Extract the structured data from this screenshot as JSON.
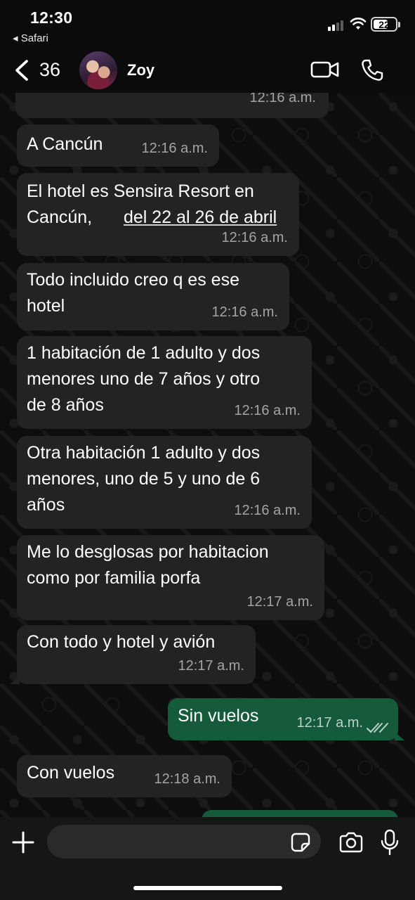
{
  "status_bar": {
    "time": "12:30",
    "back_app": "◂ Safari",
    "battery": "22"
  },
  "header": {
    "back_count": "36",
    "contact_name": "Zoy",
    "icons": [
      "chevron-left-icon",
      "video-camera-icon",
      "phone-icon"
    ]
  },
  "messages": [
    {
      "direction": "in",
      "lines": [
        ""
      ],
      "time": "12:16 a.m."
    },
    {
      "direction": "in",
      "lines": [
        "A Cancún"
      ],
      "time": "12:16 a.m."
    },
    {
      "direction": "in",
      "lines": [
        "El hotel es Sensira Resort en",
        "Cancún, "
      ],
      "link": "del 22 al 26 de abril",
      "time": "12:16 a.m."
    },
    {
      "direction": "in",
      "lines": [
        "Todo incluido creo q es ese",
        "hotel"
      ],
      "time": "12:16 a.m."
    },
    {
      "direction": "in",
      "lines": [
        "1 habitación de 1 adulto y dos",
        "menores uno de 7 años y otro",
        "de 8 años"
      ],
      "time": "12:16 a.m."
    },
    {
      "direction": "in",
      "lines": [
        "Otra habitación 1 adulto y dos",
        "menores, uno de 5 y uno de 6",
        "años"
      ],
      "time": "12:16 a.m."
    },
    {
      "direction": "in",
      "lines": [
        "Me lo desglosas por habitacion",
        "como por familia porfa"
      ],
      "time": "12:17 a.m."
    },
    {
      "direction": "in",
      "lines": [
        "Con todo y hotel y avión"
      ],
      "time": "12:17 a.m."
    },
    {
      "direction": "out",
      "lines": [
        "Sin vuelos"
      ],
      "time": "12:17 a.m.",
      "status": "read"
    },
    {
      "direction": "in",
      "lines": [
        "Con vuelos"
      ],
      "time": "12:18 a.m."
    }
  ],
  "composer": {
    "placeholder": "",
    "icons": [
      "plus-icon",
      "sticker-icon",
      "camera-icon",
      "microphone-icon"
    ]
  },
  "colors": {
    "incoming_bubble": "#232323",
    "outgoing_bubble": "#155a3b",
    "background": "#0d0d0d"
  }
}
